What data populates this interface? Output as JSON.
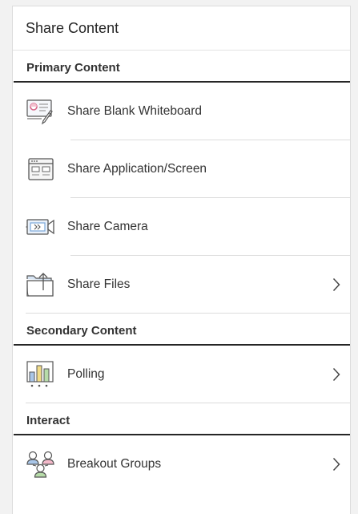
{
  "panel": {
    "title": "Share Content"
  },
  "sections": {
    "primary": {
      "title": "Primary Content",
      "items": [
        {
          "label": "Share Blank Whiteboard",
          "icon": "whiteboard-icon"
        },
        {
          "label": "Share Application/Screen",
          "icon": "application-window-icon"
        },
        {
          "label": "Share Camera",
          "icon": "camera-icon"
        },
        {
          "label": "Share Files",
          "icon": "folder-upload-icon",
          "has_submenu": true
        }
      ]
    },
    "secondary": {
      "title": "Secondary Content",
      "items": [
        {
          "label": "Polling",
          "icon": "polling-chart-icon",
          "has_submenu": true
        }
      ]
    },
    "interact": {
      "title": "Interact",
      "items": [
        {
          "label": "Breakout Groups",
          "icon": "breakout-groups-icon",
          "has_submenu": true
        }
      ]
    }
  },
  "colors": {
    "accent_blue": "#7aa7d8",
    "accent_pink": "#d9668a",
    "accent_yellow": "#e8c94e",
    "accent_green": "#8cc77a"
  }
}
